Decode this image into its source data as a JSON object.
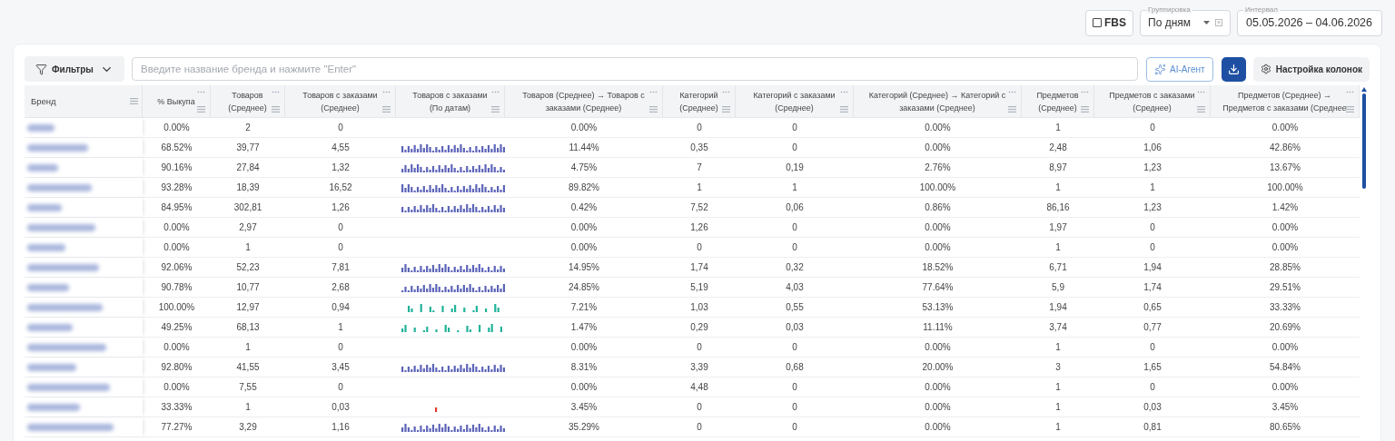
{
  "top_bar": {
    "fbs": {
      "label": "FBS",
      "checked": false
    },
    "grouping": {
      "label": "Группировка",
      "value": "По дням"
    },
    "interval": {
      "label": "Интервал",
      "value": "05.05.2026 – 04.06.2026"
    }
  },
  "toolbar": {
    "filters": "Фильтры",
    "search": {
      "placeholder": "Введите название бренда и нажмите \"Enter\""
    },
    "ai_button": "AI-Агент",
    "columns_button": "Настройка колонок"
  },
  "table": {
    "columns": [
      {
        "label": "Бренд",
        "kind": "brand"
      },
      {
        "label": "% Выкупа",
        "kind": "number"
      },
      {
        "label": "Товаров (Среднее)",
        "kind": "number"
      },
      {
        "label": "Товаров с заказами (Среднее)",
        "kind": "number"
      },
      {
        "label": "Товаров с заказами (По датам)",
        "kind": "sparkline"
      },
      {
        "label": "Товаров (Среднее) → Товаров с заказами (Среднее)",
        "kind": "number"
      },
      {
        "label": "Категорий (Среднее)",
        "kind": "number"
      },
      {
        "label": "Категорий с заказами (Среднее)",
        "kind": "number"
      },
      {
        "label": "Категорий (Среднее) → Категорий с заказами (Среднее)",
        "kind": "number"
      },
      {
        "label": "Предметов (Среднее)",
        "kind": "number"
      },
      {
        "label": "Предметов с заказами (Среднее)",
        "kind": "number"
      },
      {
        "label": "Предметов (Среднее) → Предметов с заказами (Среднее",
        "kind": "number"
      }
    ],
    "rows": [
      {
        "values": [
          "0.00%",
          "2",
          "0",
          "0.00%",
          "0",
          "0",
          "0.00%",
          "1",
          "0",
          "0.00%"
        ]
      },
      {
        "values": [
          "68.52%",
          "39,77",
          "4,55",
          "11.44%",
          "0,35",
          "0",
          "0.00%",
          "2,48",
          "1,06",
          "42.86%"
        ],
        "color": "#5c64b8"
      },
      {
        "values": [
          "90.16%",
          "27,84",
          "1,32",
          "4.75%",
          "7",
          "0,19",
          "2.76%",
          "8,97",
          "1,23",
          "13.67%"
        ],
        "color": "#5c64b8"
      },
      {
        "values": [
          "93.28%",
          "18,39",
          "16,52",
          "89.82%",
          "1",
          "1",
          "100.00%",
          "1",
          "1",
          "100.00%"
        ],
        "color": "#5c64b8"
      },
      {
        "values": [
          "84.95%",
          "302,81",
          "1,26",
          "0.42%",
          "7,52",
          "0,06",
          "0.86%",
          "86,16",
          "1,23",
          "1.42%"
        ],
        "color": "#5c64b8"
      },
      {
        "values": [
          "0.00%",
          "2,97",
          "0",
          "0.00%",
          "1,26",
          "0",
          "0.00%",
          "1,97",
          "0",
          "0.00%"
        ]
      },
      {
        "values": [
          "0.00%",
          "1",
          "0",
          "0.00%",
          "0",
          "0",
          "0.00%",
          "1",
          "0",
          "0.00%"
        ]
      },
      {
        "values": [
          "92.06%",
          "52,23",
          "7,81",
          "14.95%",
          "1,74",
          "0,32",
          "18.52%",
          "6,71",
          "1,94",
          "28.85%"
        ],
        "color": "#5c64b8"
      },
      {
        "values": [
          "90.78%",
          "10,77",
          "2,68",
          "24.85%",
          "5,19",
          "4,03",
          "77.64%",
          "5,9",
          "1,74",
          "29.51%"
        ],
        "color": "#5c64b8"
      },
      {
        "values": [
          "100.00%",
          "12,97",
          "0,94",
          "7.21%",
          "1,03",
          "0,55",
          "53.13%",
          "1,94",
          "0,65",
          "33.33%"
        ],
        "color": "#22b39a"
      },
      {
        "values": [
          "49.25%",
          "68,13",
          "1",
          "1.47%",
          "0,29",
          "0,03",
          "11.11%",
          "3,74",
          "0,77",
          "20.69%"
        ],
        "color": "#22b39a"
      },
      {
        "values": [
          "0.00%",
          "1",
          "0",
          "0.00%",
          "0",
          "0",
          "0.00%",
          "1",
          "0",
          "0.00%"
        ]
      },
      {
        "values": [
          "92.80%",
          "41,55",
          "3,45",
          "8.31%",
          "3,39",
          "0,68",
          "20.00%",
          "3",
          "1,65",
          "54.84%"
        ],
        "color": "#5c64b8"
      },
      {
        "values": [
          "0.00%",
          "7,55",
          "0",
          "0.00%",
          "4,48",
          "0",
          "0.00%",
          "1",
          "0",
          "0.00%"
        ]
      },
      {
        "values": [
          "33.33%",
          "1",
          "0,03",
          "3.45%",
          "0",
          "0",
          "0.00%",
          "1",
          "0,03",
          "3.45%"
        ],
        "color": "#e53935"
      },
      {
        "values": [
          "77.27%",
          "3,29",
          "1,16",
          "35.29%",
          "0",
          "0",
          "0.00%",
          "1",
          "0,81",
          "80.65%"
        ],
        "color": "#5c64b8"
      }
    ]
  }
}
